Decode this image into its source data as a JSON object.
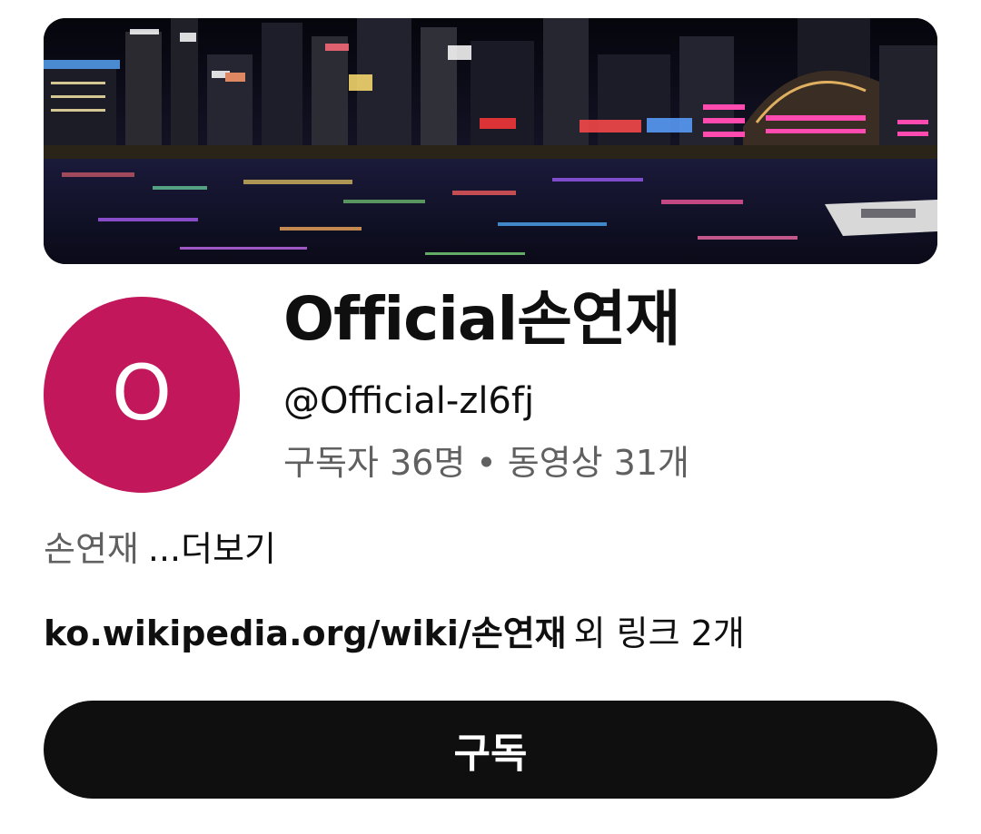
{
  "channel": {
    "name": "Official손연재",
    "handle": "@Official-zl6fj",
    "subscribers": "구독자 36명",
    "separator": "•",
    "videos": "동영상 31개",
    "avatar_letter": "O",
    "avatar_color": "#c2185b"
  },
  "description": {
    "text": "손연재",
    "more_label": "...더보기"
  },
  "links": {
    "primary_url": "ko.wikipedia.org/wiki/손연재",
    "extra_label": "외 링크 2개"
  },
  "subscribe": {
    "label": "구독",
    "background": "#0f0f0f"
  },
  "banner": {
    "description_icon": "night-city-skyline-image"
  }
}
